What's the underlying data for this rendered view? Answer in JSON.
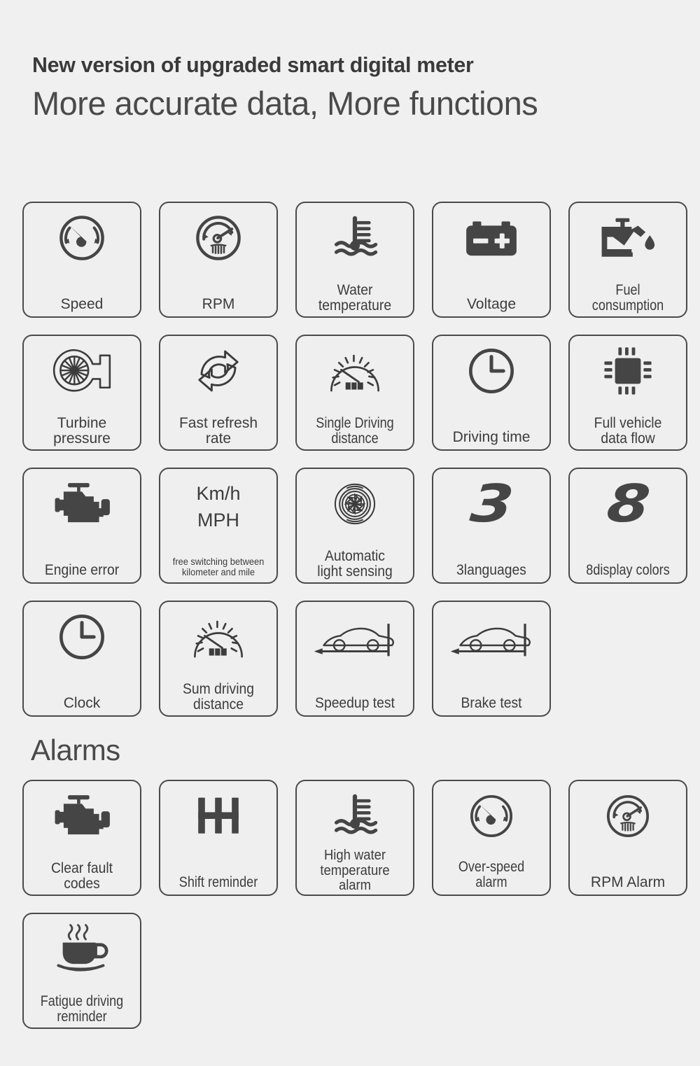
{
  "header": {
    "title": "New version of upgraded smart digital meter",
    "subtitle": "More accurate data,  More functions"
  },
  "sections": [
    {
      "id": "features",
      "heading": "",
      "items": [
        {
          "label": "Speed",
          "icon": "speedometer-icon"
        },
        {
          "label": "RPM",
          "icon": "tachometer-icon"
        },
        {
          "label": "Water\ntemperature",
          "icon": "water-temperature-icon"
        },
        {
          "label": "Voltage",
          "icon": "battery-icon"
        },
        {
          "label": "Fuel\nconsumption",
          "icon": "oil-can-icon"
        },
        {
          "label": "Turbine\npressure",
          "icon": "turbocharger-icon"
        },
        {
          "label": "Fast refresh\nrate",
          "icon": "refresh-arrows-icon"
        },
        {
          "label": "Single Driving\ndistance",
          "icon": "odometer-icon"
        },
        {
          "label": "Driving time",
          "icon": "clock-icon"
        },
        {
          "label": "Full vehicle\ndata flow",
          "icon": "chip-icon"
        },
        {
          "label": "Engine error",
          "icon": "engine-icon"
        },
        {
          "label": "",
          "icon": "unit-switch-text",
          "unit_line_1": "Km/h",
          "unit_line_2": "MPH",
          "note": "free switching between\nkilometer and mile"
        },
        {
          "label": "Automatic\nlight sensing",
          "icon": "light-sensor-icon"
        },
        {
          "label": "3languages",
          "icon": "digit-3-icon",
          "digit": "3"
        },
        {
          "label": "8display colors",
          "icon": "digit-8-icon",
          "digit": "8"
        },
        {
          "label": "Clock",
          "icon": "clock-icon"
        },
        {
          "label": "Sum driving\ndistance",
          "icon": "odometer-icon"
        },
        {
          "label": "Speedup test",
          "icon": "car-accelerate-icon"
        },
        {
          "label": "Brake test",
          "icon": "car-brake-icon"
        }
      ]
    },
    {
      "id": "alarms",
      "heading": "Alarms",
      "items": [
        {
          "label": "Clear fault\ncodes",
          "icon": "engine-icon"
        },
        {
          "label": "Shift reminder",
          "icon": "gear-shift-icon"
        },
        {
          "label": "High water\ntemperature\nalarm",
          "icon": "water-temperature-icon"
        },
        {
          "label": "Over-speed alarm",
          "icon": "speedometer-icon"
        },
        {
          "label": "RPM Alarm",
          "icon": "tachometer-icon"
        },
        {
          "label": "Fatigue driving\nreminder",
          "icon": "coffee-cup-icon"
        }
      ]
    }
  ],
  "colors": {
    "background": "#f0f0f0",
    "card_background": "#efefef",
    "stroke": "#4a4a4a",
    "text": "#3c3c3c",
    "icon_fill": "#454545"
  }
}
